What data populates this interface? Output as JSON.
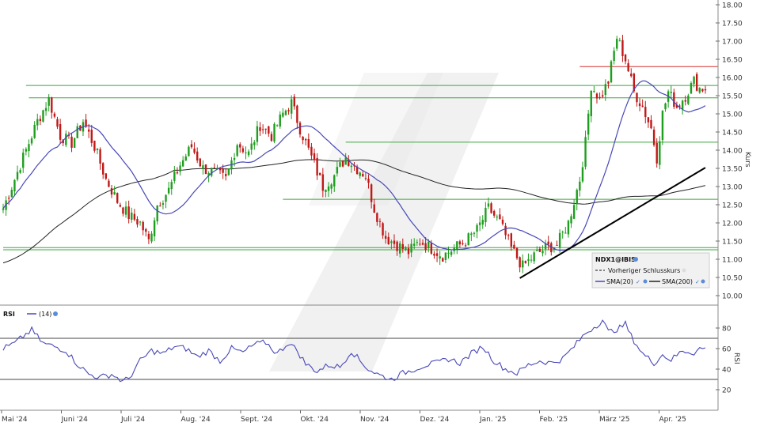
{
  "chart_data": [
    {
      "type": "candlestick",
      "symbol": "NDX1@IBIS",
      "ylabel": "Kurs",
      "ylim": [
        9.8,
        18.0
      ],
      "yticks": [
        "10.00",
        "10.50",
        "11.00",
        "11.50",
        "12.00",
        "12.50",
        "13.00",
        "13.50",
        "14.00",
        "14.50",
        "15.00",
        "15.50",
        "16.00",
        "16.50",
        "17.00",
        "17.50",
        "18.00"
      ],
      "x_labels": [
        "Mai '24",
        "Juni '24",
        "Juli '24",
        "Aug. '24",
        "Sept. '24",
        "Okt. '24",
        "Nov. '24",
        "Dez. '24",
        "Jan. '25",
        "Feb. '25",
        "März '25",
        "Apr. '25"
      ],
      "colors": {
        "up": "#1e9e1e",
        "down": "#c01818",
        "sma20": "#4848b8",
        "sma200": "#222222",
        "hline_green": "#3fa83f",
        "hline_red": "#d23030",
        "trend": "#000000"
      },
      "close_anchors": [
        {
          "day": 0,
          "close": 12.4
        },
        {
          "day": 6,
          "close": 13.6
        },
        {
          "day": 12,
          "close": 14.8
        },
        {
          "day": 16,
          "close": 15.4
        },
        {
          "day": 20,
          "close": 14.4
        },
        {
          "day": 24,
          "close": 14.2
        },
        {
          "day": 28,
          "close": 14.8
        },
        {
          "day": 32,
          "close": 14.1
        },
        {
          "day": 36,
          "close": 13.2
        },
        {
          "day": 40,
          "close": 12.6
        },
        {
          "day": 44,
          "close": 12.2
        },
        {
          "day": 48,
          "close": 12.0
        },
        {
          "day": 51,
          "close": 11.5
        },
        {
          "day": 54,
          "close": 12.5
        },
        {
          "day": 58,
          "close": 12.9
        },
        {
          "day": 62,
          "close": 13.6
        },
        {
          "day": 66,
          "close": 14.1
        },
        {
          "day": 70,
          "close": 13.5
        },
        {
          "day": 74,
          "close": 13.4
        },
        {
          "day": 78,
          "close": 13.2
        },
        {
          "day": 82,
          "close": 14.2
        },
        {
          "day": 86,
          "close": 13.9
        },
        {
          "day": 90,
          "close": 14.7
        },
        {
          "day": 94,
          "close": 14.4
        },
        {
          "day": 98,
          "close": 15.0
        },
        {
          "day": 101,
          "close": 15.3
        },
        {
          "day": 104,
          "close": 14.6
        },
        {
          "day": 108,
          "close": 13.8
        },
        {
          "day": 112,
          "close": 13.0
        },
        {
          "day": 116,
          "close": 13.3
        },
        {
          "day": 120,
          "close": 13.8
        },
        {
          "day": 124,
          "close": 13.5
        },
        {
          "day": 127,
          "close": 13.3
        },
        {
          "day": 130,
          "close": 12.4
        },
        {
          "day": 134,
          "close": 11.6
        },
        {
          "day": 138,
          "close": 11.4
        },
        {
          "day": 142,
          "close": 11.2
        },
        {
          "day": 146,
          "close": 11.5
        },
        {
          "day": 150,
          "close": 11.3
        },
        {
          "day": 154,
          "close": 11.1
        },
        {
          "day": 158,
          "close": 11.3
        },
        {
          "day": 162,
          "close": 11.5
        },
        {
          "day": 166,
          "close": 11.8
        },
        {
          "day": 170,
          "close": 12.4
        },
        {
          "day": 174,
          "close": 12.0
        },
        {
          "day": 178,
          "close": 11.3
        },
        {
          "day": 182,
          "close": 10.8
        },
        {
          "day": 186,
          "close": 11.1
        },
        {
          "day": 190,
          "close": 11.3
        },
        {
          "day": 194,
          "close": 11.4
        },
        {
          "day": 198,
          "close": 12.0
        },
        {
          "day": 202,
          "close": 13.2
        },
        {
          "day": 204,
          "close": 14.2
        },
        {
          "day": 206,
          "close": 15.8
        },
        {
          "day": 209,
          "close": 15.4
        },
        {
          "day": 212,
          "close": 15.9
        },
        {
          "day": 215,
          "close": 17.1
        },
        {
          "day": 218,
          "close": 16.5
        },
        {
          "day": 221,
          "close": 15.6
        },
        {
          "day": 224,
          "close": 15.2
        },
        {
          "day": 227,
          "close": 14.6
        },
        {
          "day": 229,
          "close": 13.8
        },
        {
          "day": 231,
          "close": 15.0
        },
        {
          "day": 233,
          "close": 15.6
        },
        {
          "day": 236,
          "close": 15.2
        },
        {
          "day": 239,
          "close": 15.5
        },
        {
          "day": 242,
          "close": 15.9
        },
        {
          "day": 244,
          "close": 15.7
        }
      ],
      "horizontal_lines": [
        {
          "price": 15.78,
          "color": "green",
          "from_day": 8
        },
        {
          "price": 15.44,
          "color": "green",
          "from_day": 9
        },
        {
          "price": 14.22,
          "color": "green",
          "from_day": 120
        },
        {
          "price": 12.65,
          "color": "green",
          "from_day": 98
        },
        {
          "price": 11.32,
          "color": "green",
          "from_day": 0
        },
        {
          "price": 11.26,
          "color": "green",
          "from_day": 0
        },
        {
          "price": 16.3,
          "color": "red",
          "from_day": 202
        }
      ],
      "trendline": [
        {
          "day": 181,
          "price": 10.48
        },
        {
          "day": 246,
          "price": 13.52
        }
      ],
      "legend": {
        "title": "NDX1@IBIS",
        "items": [
          {
            "label": "Vorheriger Schlusskurs",
            "style": "dashed"
          },
          {
            "label": "SMA(20)",
            "color": "#4848b8"
          },
          {
            "label": "SMA(200)",
            "color": "#222222"
          }
        ]
      }
    },
    {
      "type": "line",
      "title": "RSI",
      "series_label": "(14)",
      "ylabel": "RSI",
      "ylim": [
        0,
        100
      ],
      "yticks": [
        "20",
        "40",
        "60",
        "80"
      ],
      "reference_levels": [
        30,
        70
      ],
      "anchors": [
        {
          "day": 0,
          "rsi": 60
        },
        {
          "day": 4,
          "rsi": 65
        },
        {
          "day": 8,
          "rsi": 74
        },
        {
          "day": 10,
          "rsi": 78
        },
        {
          "day": 14,
          "rsi": 65
        },
        {
          "day": 18,
          "rsi": 62
        },
        {
          "day": 22,
          "rsi": 58
        },
        {
          "day": 26,
          "rsi": 45
        },
        {
          "day": 30,
          "rsi": 35
        },
        {
          "day": 34,
          "rsi": 32
        },
        {
          "day": 38,
          "rsi": 35
        },
        {
          "day": 42,
          "rsi": 28
        },
        {
          "day": 44,
          "rsi": 31
        },
        {
          "day": 48,
          "rsi": 48
        },
        {
          "day": 52,
          "rsi": 58
        },
        {
          "day": 56,
          "rsi": 55
        },
        {
          "day": 60,
          "rsi": 62
        },
        {
          "day": 64,
          "rsi": 60
        },
        {
          "day": 68,
          "rsi": 52
        },
        {
          "day": 72,
          "rsi": 58
        },
        {
          "day": 76,
          "rsi": 48
        },
        {
          "day": 80,
          "rsi": 60
        },
        {
          "day": 84,
          "rsi": 56
        },
        {
          "day": 88,
          "rsi": 64
        },
        {
          "day": 92,
          "rsi": 66
        },
        {
          "day": 96,
          "rsi": 55
        },
        {
          "day": 100,
          "rsi": 66
        },
        {
          "day": 103,
          "rsi": 58
        },
        {
          "day": 106,
          "rsi": 45
        },
        {
          "day": 110,
          "rsi": 38
        },
        {
          "day": 114,
          "rsi": 44
        },
        {
          "day": 118,
          "rsi": 42
        },
        {
          "day": 122,
          "rsi": 58
        },
        {
          "day": 125,
          "rsi": 48
        },
        {
          "day": 128,
          "rsi": 40
        },
        {
          "day": 132,
          "rsi": 34
        },
        {
          "day": 136,
          "rsi": 30
        },
        {
          "day": 140,
          "rsi": 36
        },
        {
          "day": 144,
          "rsi": 40
        },
        {
          "day": 148,
          "rsi": 44
        },
        {
          "day": 152,
          "rsi": 46
        },
        {
          "day": 156,
          "rsi": 50
        },
        {
          "day": 160,
          "rsi": 46
        },
        {
          "day": 164,
          "rsi": 55
        },
        {
          "day": 168,
          "rsi": 62
        },
        {
          "day": 172,
          "rsi": 48
        },
        {
          "day": 176,
          "rsi": 40
        },
        {
          "day": 180,
          "rsi": 36
        },
        {
          "day": 184,
          "rsi": 44
        },
        {
          "day": 188,
          "rsi": 48
        },
        {
          "day": 192,
          "rsi": 46
        },
        {
          "day": 196,
          "rsi": 50
        },
        {
          "day": 200,
          "rsi": 62
        },
        {
          "day": 204,
          "rsi": 75
        },
        {
          "day": 208,
          "rsi": 83
        },
        {
          "day": 210,
          "rsi": 88
        },
        {
          "day": 212,
          "rsi": 76
        },
        {
          "day": 216,
          "rsi": 80
        },
        {
          "day": 218,
          "rsi": 84
        },
        {
          "day": 220,
          "rsi": 72
        },
        {
          "day": 224,
          "rsi": 55
        },
        {
          "day": 228,
          "rsi": 46
        },
        {
          "day": 231,
          "rsi": 54
        },
        {
          "day": 234,
          "rsi": 49
        },
        {
          "day": 238,
          "rsi": 58
        },
        {
          "day": 242,
          "rsi": 56
        },
        {
          "day": 244,
          "rsi": 60
        }
      ]
    }
  ]
}
